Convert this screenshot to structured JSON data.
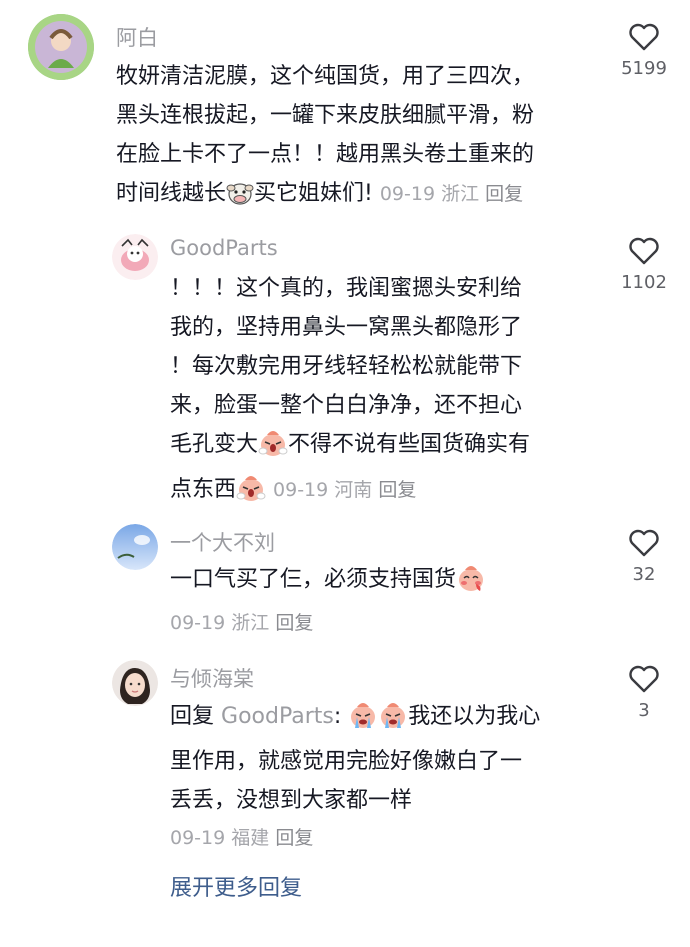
{
  "comments": [
    {
      "username": "阿白",
      "text_lines": [
        "牧妍清洁泥膜，这个纯国货，用了三四次，",
        "黑头连根拔起，一罐下来皮肤细腻平滑，粉",
        "在脸上卡不了一点！！越用黑头卷土重来的"
      ],
      "last_line_a": "时间线越长",
      "emoji": "cow-emoji",
      "last_line_b": "买它姐妹们!",
      "date": "09-19",
      "location": "浙江",
      "reply_label": "回复",
      "likes": "5199"
    },
    {
      "username": "GoodParts",
      "text_lines": [
        "！！！这个真的，我闺蜜摁头安利给",
        "我的，坚持用鼻头一窝黑头都隐形了",
        "！每次敷完用牙线轻轻松松就能带下",
        "来，脸蛋一整个白白净净，还不担心"
      ],
      "line5_a": "毛孔变大",
      "line5_b": "不得不说有些国货确实有",
      "line6_a": "点东西",
      "emoji": "shocked-face-emoji",
      "date": "09-19",
      "location": "河南",
      "reply_label": "回复",
      "likes": "1102"
    },
    {
      "username": "一个大不刘",
      "text": "一口气买了仨，必须支持国货",
      "emoji": "blushing-face-emoji",
      "date": "09-19",
      "location": "浙江",
      "reply_label": "回复",
      "likes": "32"
    },
    {
      "username": "与倾海棠",
      "reply_prefix": "回复",
      "reply_to": "GoodParts",
      "reply_colon": ":",
      "line1_b": "我还以为我心",
      "text_lines": [
        "里作用，就感觉用完脸好像嫩白了一",
        "丢丢，没想到大家都一样"
      ],
      "emoji": "crying-face-emoji",
      "date": "09-19",
      "location": "福建",
      "reply_label": "回复",
      "likes": "3"
    }
  ],
  "expand_more": "展开更多回复",
  "colors": {
    "accent_link": "#3e5d8c",
    "muted": "#9b9ca1",
    "text": "#161823"
  }
}
